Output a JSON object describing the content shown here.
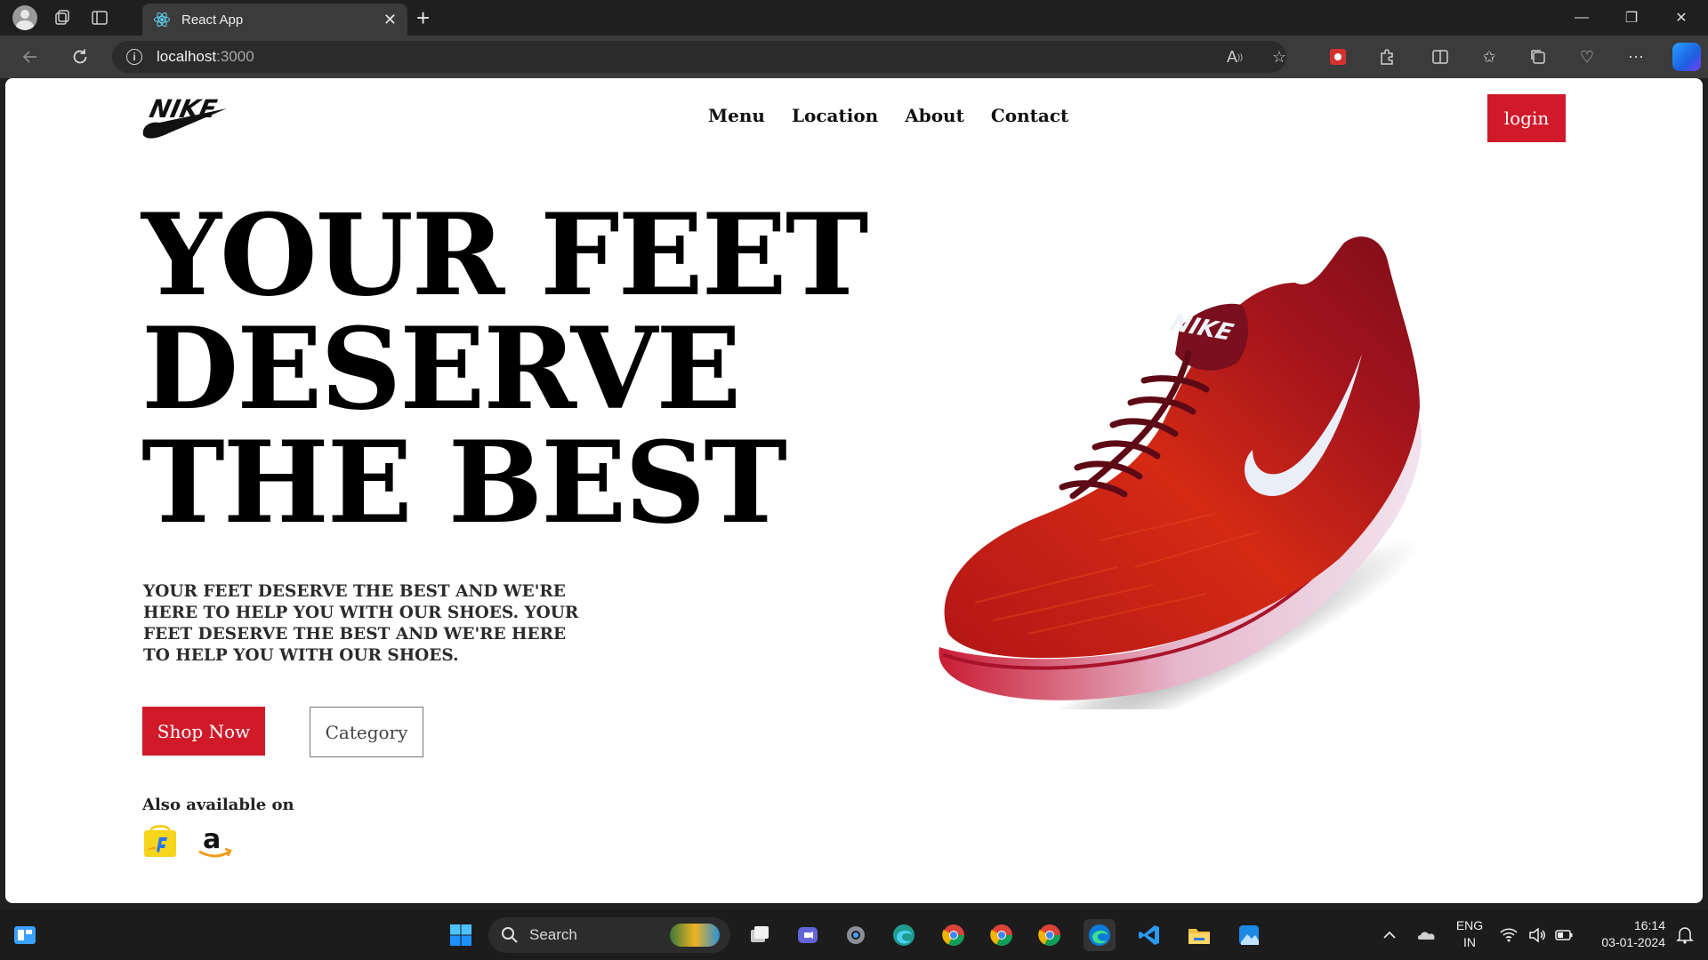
{
  "browser": {
    "tab_title": "React App",
    "new_tab_symbol": "+",
    "url_host": "localhost",
    "url_port": ":3000",
    "window_controls": [
      "—",
      "❐",
      "✕"
    ]
  },
  "nav": {
    "items": [
      {
        "label": "Menu"
      },
      {
        "label": "Location"
      },
      {
        "label": "About"
      },
      {
        "label": "Contact"
      }
    ],
    "login_label": "login"
  },
  "hero": {
    "lines": [
      "YOUR FEET",
      "DESERVE",
      "THE BEST"
    ],
    "description": "YOUR FEET DESERVE THE BEST AND WE'RE HERE TO HELP YOU WITH OUR SHOES. YOUR FEET DESERVE THE BEST AND WE'RE HERE TO HELP YOU WITH OUR SHOES.",
    "shop_now_label": "Shop Now",
    "category_label": "Category",
    "also_available": "Also available on"
  },
  "colors": {
    "accent": "#d01a2a",
    "text": "#000000"
  },
  "icons": [
    "nike-logo-icon",
    "flipkart-icon",
    "amazon-icon",
    "shoe-image"
  ],
  "taskbar": {
    "search_label": "Search",
    "language": "ENG",
    "region": "IN",
    "time": "16:14",
    "date": "03-01-2024"
  }
}
